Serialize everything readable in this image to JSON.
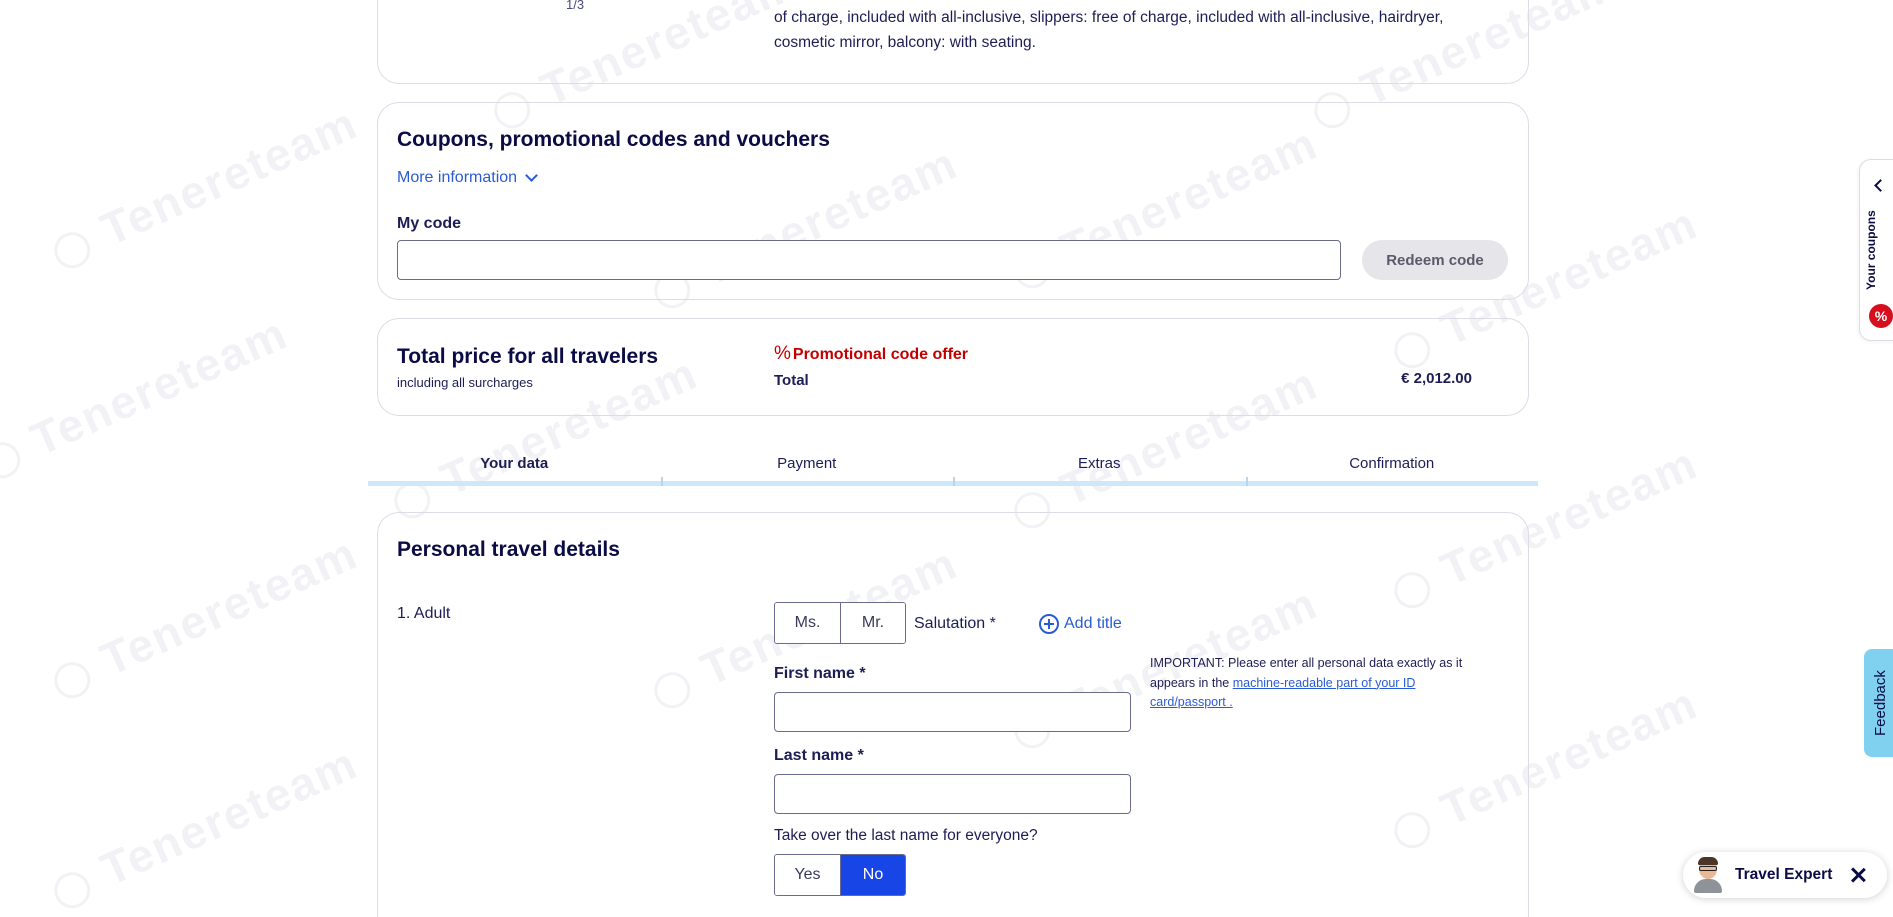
{
  "room": {
    "number_fragment": "1/3",
    "description": "of charge, included with all-inclusive, slippers: free of charge, included with all-inclusive, hairdryer, cosmetic mirror, balcony: with seating."
  },
  "coupons": {
    "title": "Coupons, promotional codes and vouchers",
    "more_info": "More information",
    "code_label": "My code",
    "code_value": "",
    "redeem_label": "Redeem code"
  },
  "total": {
    "title": "Total price for all travelers",
    "subtitle": "including all surcharges",
    "promo_symbol": "%",
    "promo_label": "Promotional code offer",
    "total_label": "Total",
    "total_value": "€ 2,012.00"
  },
  "steps": [
    {
      "label": "Your data",
      "active": true
    },
    {
      "label": "Payment",
      "active": false
    },
    {
      "label": "Extras",
      "active": false
    },
    {
      "label": "Confirmation",
      "active": false
    }
  ],
  "personal": {
    "title": "Personal travel details",
    "adult_label": "1. Adult",
    "salutation_options": [
      "Ms.",
      "Mr."
    ],
    "salutation_label": "Salutation *",
    "add_title": "Add title",
    "first_name_label": "First name *",
    "last_name_label": "Last name *",
    "important_text": "IMPORTANT: Please enter all personal data exactly as it appears in the ",
    "important_link": "machine-readable part of your ID card/passport .",
    "takeover_question": "Take over the last name for everyone?",
    "takeover_options": [
      "Yes",
      "No"
    ],
    "takeover_selected": "No"
  },
  "side": {
    "coupons_tab": "Your coupons",
    "coupons_badge": "%",
    "feedback_tab": "Feedback"
  },
  "expert": {
    "label": "Travel Expert"
  },
  "watermark": {
    "text": "Tenereteam"
  },
  "colors": {
    "primary_blue": "#1846e6",
    "link_blue": "#2a5bd7",
    "promo_red": "#c20000",
    "step_bar": "#cde8fa",
    "feedback_bg": "#7fd1ef",
    "text_navy": "#0b0b45"
  }
}
